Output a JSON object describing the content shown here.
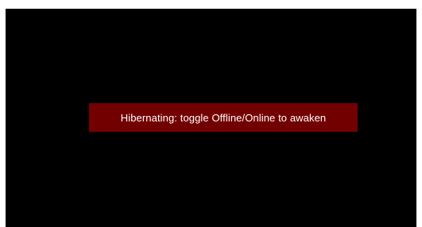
{
  "hibernation": {
    "message": "Hibernating: toggle Offline/Online to awaken",
    "background_color": "#000000",
    "banner_color": "#730000",
    "text_color": "#ffffff"
  }
}
